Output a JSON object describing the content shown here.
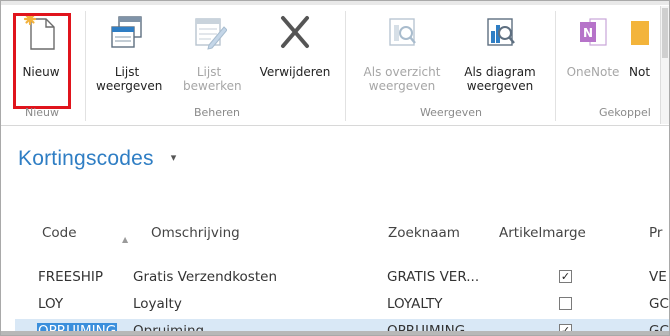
{
  "ribbon": {
    "buttons": [
      {
        "id": "new",
        "label": "Nieuw",
        "icon": "new-document-icon",
        "enabled": true
      },
      {
        "id": "list_view",
        "label": "Lijst weergeven",
        "icon": "list-view-icon",
        "enabled": true
      },
      {
        "id": "list_edit",
        "label": "Lijst bewerken",
        "icon": "edit-list-icon",
        "enabled": false
      },
      {
        "id": "delete",
        "label": "Verwijderen",
        "icon": "delete-x-icon",
        "enabled": true
      },
      {
        "id": "as_overview",
        "label": "Als overzicht weergeven",
        "icon": "overview-icon",
        "enabled": false
      },
      {
        "id": "as_chart",
        "label": "Als diagram weergeven",
        "icon": "chart-icon",
        "enabled": true
      },
      {
        "id": "onenote",
        "label": "OneNote",
        "icon": "onenote-icon",
        "enabled": false
      },
      {
        "id": "notes",
        "label": "Not",
        "icon": "notes-icon",
        "enabled": true
      }
    ],
    "groups": [
      "Nieuw",
      "Beheren",
      "Weergeven",
      "Gekoppel"
    ]
  },
  "page": {
    "title": "Kortingscodes",
    "title_caret": "▾"
  },
  "table": {
    "headers": [
      "Code",
      "Omschrijving",
      "Zoeknaam",
      "Artikelmarge",
      "Pr"
    ],
    "sort_indicator": "▲",
    "rows": [
      {
        "code": "FREESHIP",
        "description": "Gratis Verzendkosten",
        "search_name": "GRATIS VER...",
        "item_margin": true,
        "extra": "VE",
        "selected": false
      },
      {
        "code": "LOY",
        "description": "Loyalty",
        "search_name": "LOYALTY",
        "item_margin": false,
        "extra": "GC",
        "selected": false
      },
      {
        "code": "OPRUIMING",
        "description": "Opruiming",
        "search_name": "OPRUIMING",
        "item_margin": true,
        "extra": "GC",
        "selected": true
      }
    ]
  },
  "colors": {
    "title": "#2f7ec4",
    "highlight_box": "#e0141c",
    "selection": "#3b8fdc"
  }
}
